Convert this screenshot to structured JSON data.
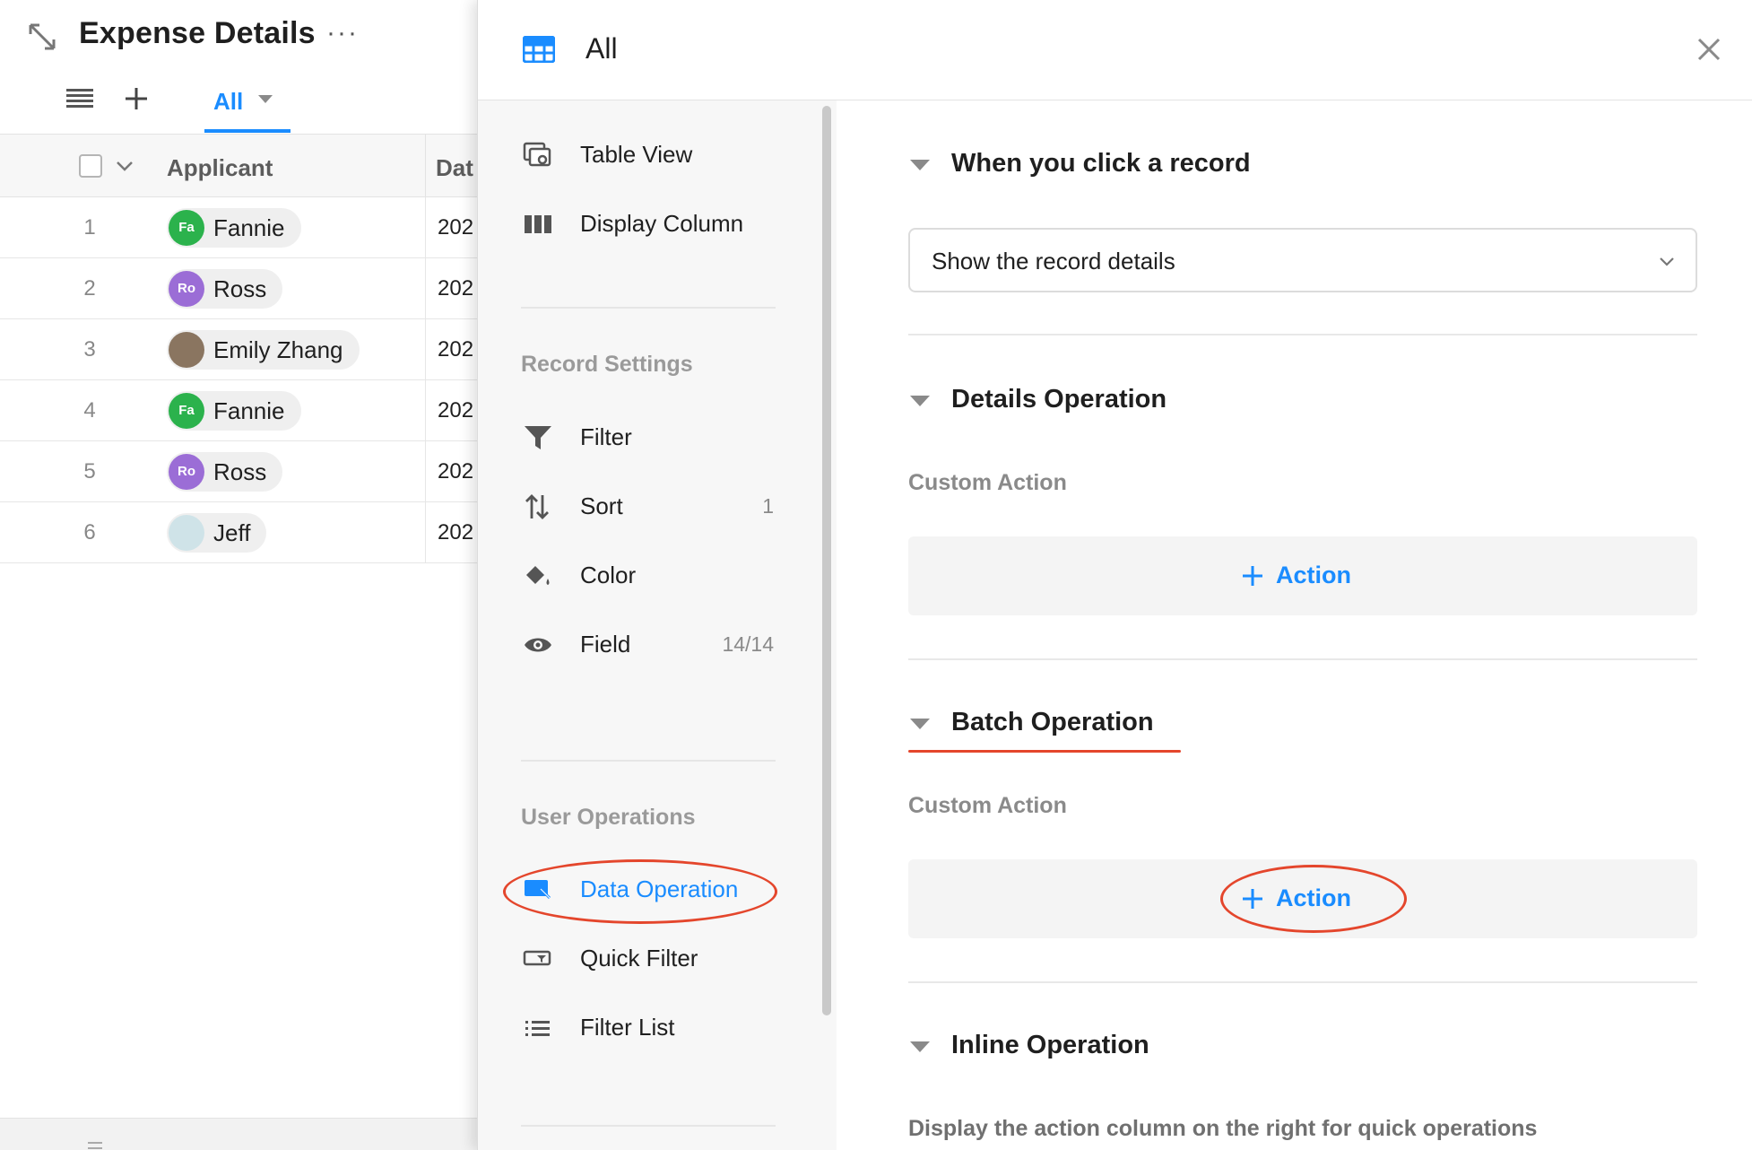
{
  "page": {
    "title": "Expense Details",
    "more": "···"
  },
  "toolbar": {
    "active_tab": "All"
  },
  "table": {
    "columns": [
      "Applicant",
      "Dat"
    ],
    "rows": [
      {
        "num": "1",
        "name": "Fannie",
        "initials": "Fa",
        "avatar_color": "#2bb24c",
        "date": "202"
      },
      {
        "num": "2",
        "name": "Ross",
        "initials": "Ro",
        "avatar_color": "#9b6dd6",
        "date": "202"
      },
      {
        "num": "3",
        "name": "Emily Zhang",
        "initials": "",
        "avatar_color": "#8a7560",
        "date": "202"
      },
      {
        "num": "4",
        "name": "Fannie",
        "initials": "Fa",
        "avatar_color": "#2bb24c",
        "date": "202"
      },
      {
        "num": "5",
        "name": "Ross",
        "initials": "Ro",
        "avatar_color": "#9b6dd6",
        "date": "202"
      },
      {
        "num": "6",
        "name": "Jeff",
        "initials": "",
        "avatar_color": "#cfe3e8",
        "date": "202"
      }
    ]
  },
  "drawer": {
    "title": "All",
    "nav": {
      "table_view": "Table View",
      "display_column": "Display Column",
      "record_settings": "Record Settings",
      "filter": "Filter",
      "sort": "Sort",
      "sort_count": "1",
      "color": "Color",
      "field": "Field",
      "field_count": "14/14",
      "user_operations": "User Operations",
      "data_operation": "Data Operation",
      "quick_filter": "Quick Filter",
      "filter_list": "Filter List"
    },
    "settings": {
      "click_record_title": "When you click a record",
      "click_record_value": "Show the record details",
      "details_title": "Details Operation",
      "details_custom_action": "Custom Action",
      "details_action_label": "Action",
      "batch_title": "Batch Operation",
      "batch_custom_action": "Custom Action",
      "batch_action_label": "Action",
      "inline_title": "Inline Operation",
      "inline_desc": "Display the action column on the right for quick operations"
    }
  },
  "colors": {
    "accent": "#1a8cff",
    "annotation": "#e4462c"
  }
}
